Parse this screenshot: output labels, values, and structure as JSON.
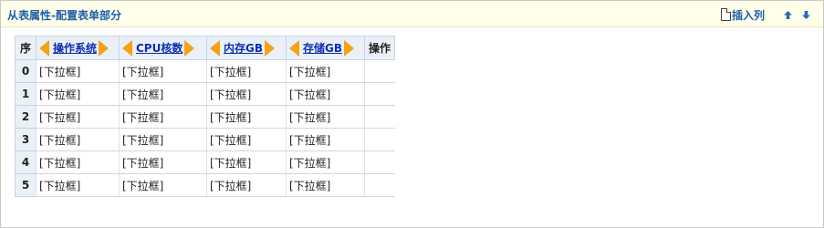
{
  "panel": {
    "title": "从表属性-配置表单部分"
  },
  "toolbar": {
    "insert_column_label": "插入列",
    "doc_icon": "document-icon",
    "move_up_icon": "arrow-up-icon",
    "move_down_icon": "arrow-down-icon"
  },
  "grid": {
    "seq_header": "序",
    "ops_header": "操作",
    "columns": [
      {
        "label": "操作系统"
      },
      {
        "label": "CPU核数"
      },
      {
        "label": "内存GB"
      },
      {
        "label": "存储GB"
      }
    ],
    "rows": [
      {
        "index": "0",
        "cells": [
          "[下拉框]",
          "[下拉框]",
          "[下拉框]",
          "[下拉框]"
        ]
      },
      {
        "index": "1",
        "cells": [
          "[下拉框]",
          "[下拉框]",
          "[下拉框]",
          "[下拉框]"
        ]
      },
      {
        "index": "2",
        "cells": [
          "[下拉框]",
          "[下拉框]",
          "[下拉框]",
          "[下拉框]"
        ]
      },
      {
        "index": "3",
        "cells": [
          "[下拉框]",
          "[下拉框]",
          "[下拉框]",
          "[下拉框]"
        ]
      },
      {
        "index": "4",
        "cells": [
          "[下拉框]",
          "[下拉框]",
          "[下拉框]",
          "[下拉框]"
        ]
      },
      {
        "index": "5",
        "cells": [
          "[下拉框]",
          "[下拉框]",
          "[下拉框]",
          "[下拉框]"
        ]
      }
    ]
  },
  "colors": {
    "header_bg": "#ffffea",
    "title_blue": "#2060a8",
    "link_blue": "#1030b0",
    "arrow_orange": "#f5a315",
    "grid_header_bg": "#e9f0f8"
  }
}
